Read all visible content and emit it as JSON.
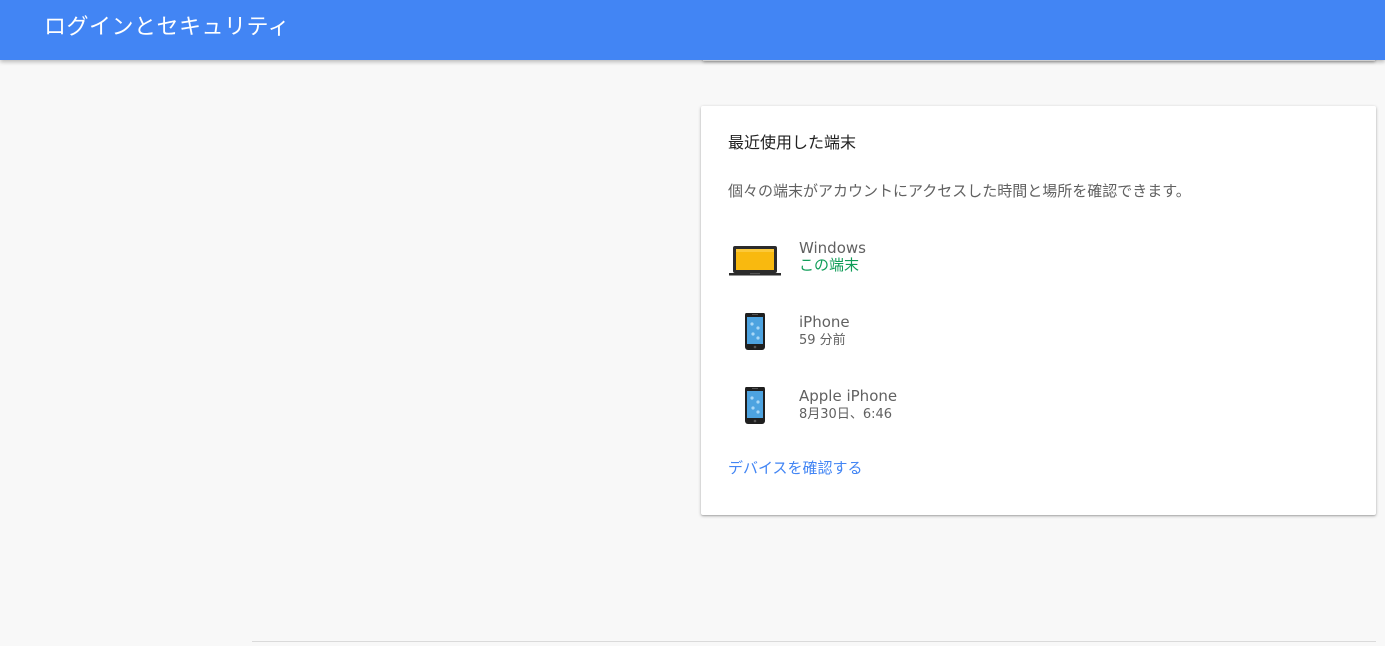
{
  "header": {
    "title": "ログインとセキュリティ",
    "color": "#4285f4"
  },
  "card": {
    "title": "最近使用した端末",
    "description": "個々の端末がアカウントにアクセスした時間と場所を確認できます。",
    "devices": [
      {
        "icon": "laptop-icon",
        "name": "Windows",
        "status": "この端末",
        "status_color": "#0f9d58"
      },
      {
        "icon": "smartphone-icon",
        "name": "iPhone",
        "status": "59 分前"
      },
      {
        "icon": "smartphone-icon",
        "name": "Apple iPhone",
        "status": "8月30日、6:46"
      }
    ],
    "link_label": "デバイスを確認する",
    "link_color": "#4285f4"
  }
}
